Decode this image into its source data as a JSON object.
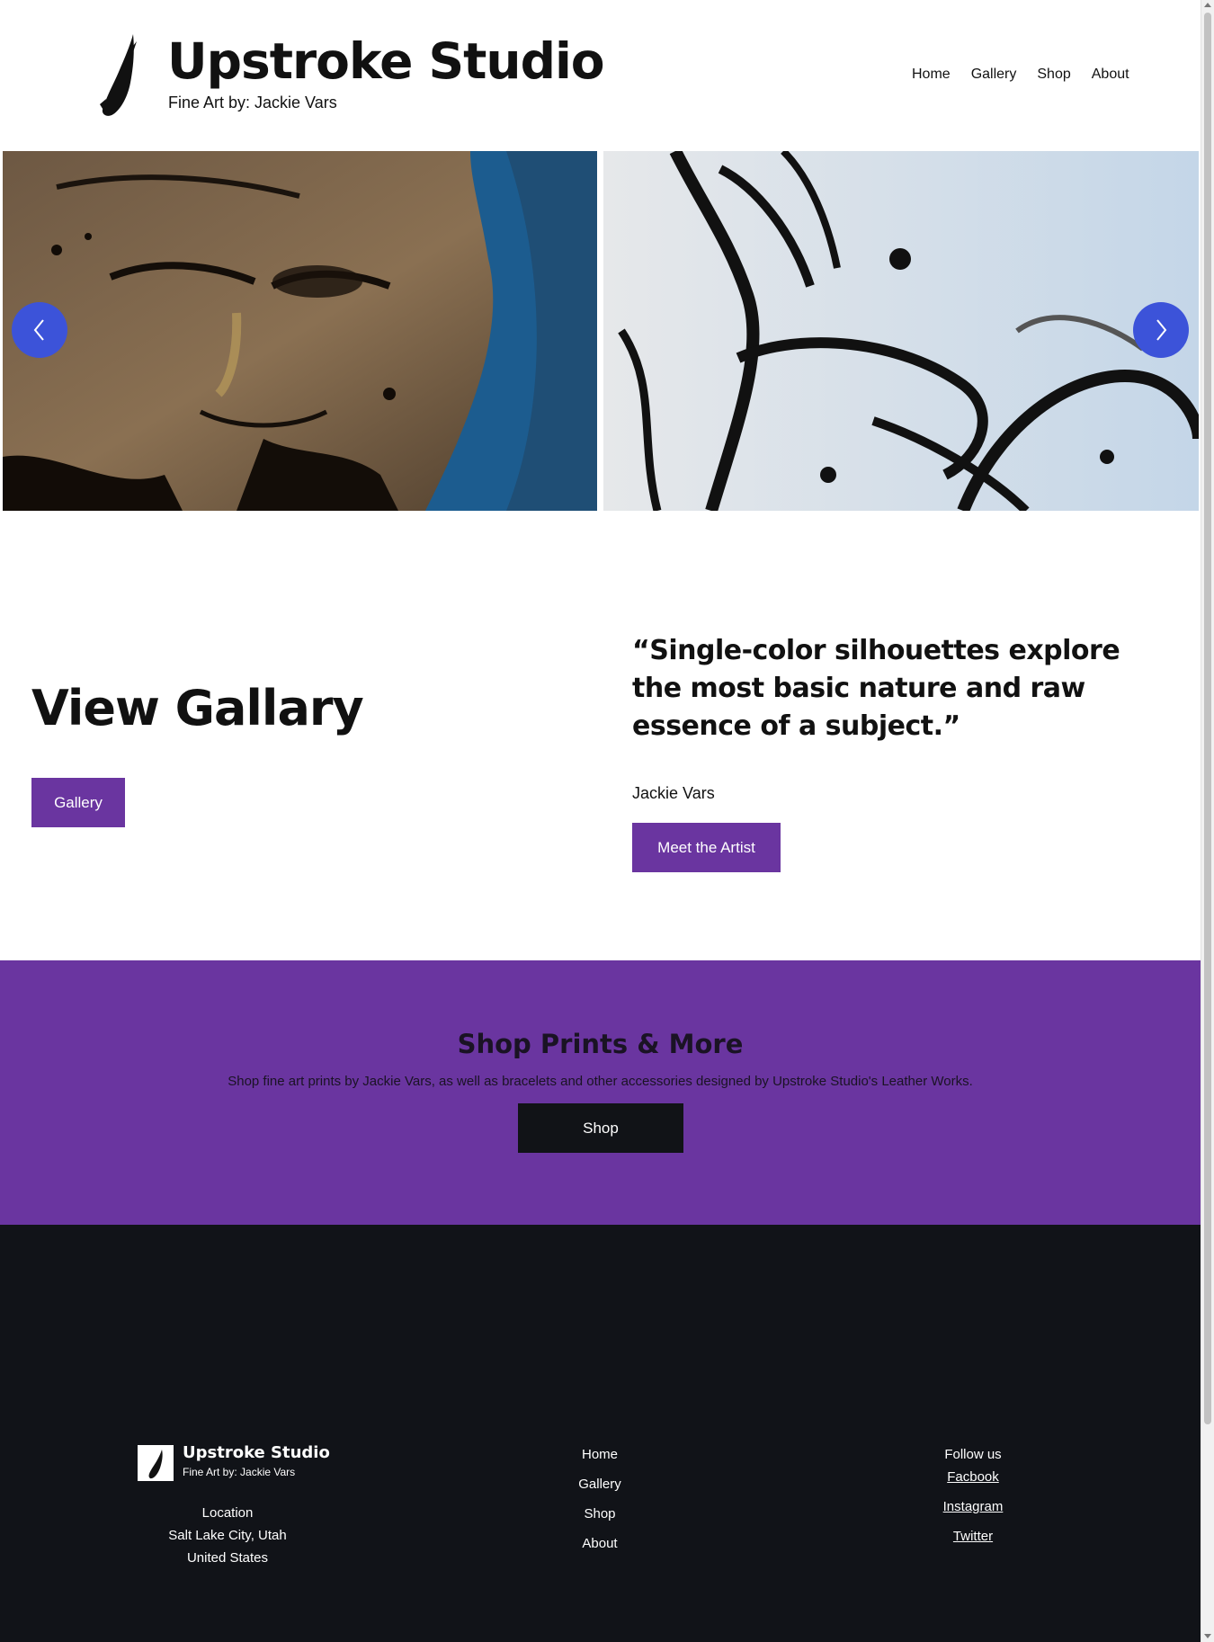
{
  "header": {
    "title": "Upstroke Studio",
    "tagline": "Fine Art by: Jackie Vars",
    "nav": [
      "Home",
      "Gallery",
      "Shop",
      "About"
    ]
  },
  "slider": {
    "prev_icon": "chevron-left-icon",
    "next_icon": "chevron-right-icon",
    "button_color": "#3c53d9"
  },
  "gallery_section": {
    "heading": "View Gallary",
    "button_label": "Gallery"
  },
  "quote_section": {
    "quote": "“Single-color silhouettes explore the most basic nature and raw essence of a subject.”",
    "author": "Jackie Vars",
    "button_label": "Meet the Artist"
  },
  "shop_section": {
    "title": "Shop Prints & More",
    "description": "Shop fine art prints by Jackie Vars, as well as bracelets and other accessories designed by Upstroke Studio's Leather Works.",
    "button_label": "Shop",
    "background_color": "#6a35a0"
  },
  "footer": {
    "title": "Upstroke Studio",
    "tagline": "Fine Art by: Jackie Vars",
    "location_label": "Location",
    "location_city": "Salt Lake City, Utah",
    "location_country": "United States",
    "nav": [
      "Home",
      "Gallery",
      "Shop",
      "About"
    ],
    "follow_label": "Follow us",
    "social": [
      "Facbook",
      "Instagram",
      "Twitter"
    ],
    "background_color": "#111318"
  },
  "colors": {
    "accent_purple": "#6a35a0",
    "dark": "#111318"
  }
}
